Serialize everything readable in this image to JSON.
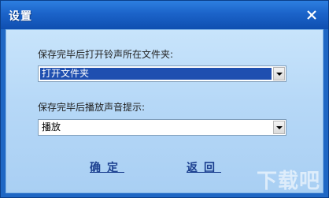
{
  "window": {
    "title": "设置",
    "close_icon": "close-icon"
  },
  "form": {
    "folder_label": "保存完毕后打开铃声所在文件夹:",
    "folder_value": "打开文件夹",
    "sound_label": "保存完毕后播放声音提示:",
    "sound_value": "播放"
  },
  "buttons": {
    "ok_label": "确定",
    "back_label": "返回"
  },
  "watermark": {
    "text": "下载吧"
  },
  "colors": {
    "title_bar": "#1b63c9",
    "content_bg": "#b6d8f7",
    "selection": "#1f4fb0",
    "link": "#1b3f8f"
  }
}
